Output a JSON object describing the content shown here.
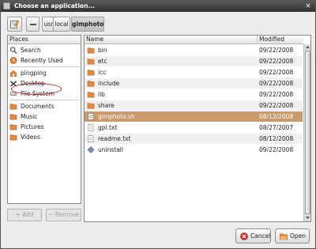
{
  "window": {
    "title": "Choose an application..."
  },
  "path_bar": {
    "crumbs": [
      "usr",
      "local",
      "gimphoto"
    ],
    "active": "gimphoto"
  },
  "places": {
    "header": "Places",
    "items": [
      {
        "label": "Search",
        "icon": "search-icon"
      },
      {
        "label": "Recently Used",
        "icon": "recent-icon"
      },
      {
        "label": "pingping",
        "icon": "home-folder-icon"
      },
      {
        "label": "Desktop",
        "icon": "desktop-icon"
      },
      {
        "label": "File System",
        "icon": "drive-icon"
      },
      {
        "label": "Documents",
        "icon": "folder-icon"
      },
      {
        "label": "Music",
        "icon": "folder-icon"
      },
      {
        "label": "Pictures",
        "icon": "folder-icon"
      },
      {
        "label": "Videos",
        "icon": "folder-icon"
      }
    ],
    "add_label": "Add",
    "remove_label": "Remove"
  },
  "files": {
    "columns": {
      "name": "Name",
      "modified": "Modified"
    },
    "rows": [
      {
        "name": "bin",
        "modified": "09/22/2008",
        "type": "folder"
      },
      {
        "name": "etc",
        "modified": "09/22/2008",
        "type": "folder"
      },
      {
        "name": "icc",
        "modified": "09/22/2008",
        "type": "folder"
      },
      {
        "name": "include",
        "modified": "09/22/2008",
        "type": "folder"
      },
      {
        "name": "lib",
        "modified": "09/22/2008",
        "type": "folder"
      },
      {
        "name": "share",
        "modified": "09/22/2008",
        "type": "folder"
      },
      {
        "name": "gimphoto.sh",
        "modified": "08/12/2008",
        "type": "script",
        "selected": true
      },
      {
        "name": "gpl.txt",
        "modified": "08/27/2007",
        "type": "text"
      },
      {
        "name": "readme.txt",
        "modified": "08/12/2008",
        "type": "text"
      },
      {
        "name": "uninstall",
        "modified": "09/22/2008",
        "type": "executable"
      }
    ]
  },
  "buttons": {
    "cancel": "Cancel",
    "open": "Open"
  },
  "colors": {
    "selection": "#c99a6b",
    "folder": "#e8893a",
    "titlebar": "#3a3a3a"
  }
}
